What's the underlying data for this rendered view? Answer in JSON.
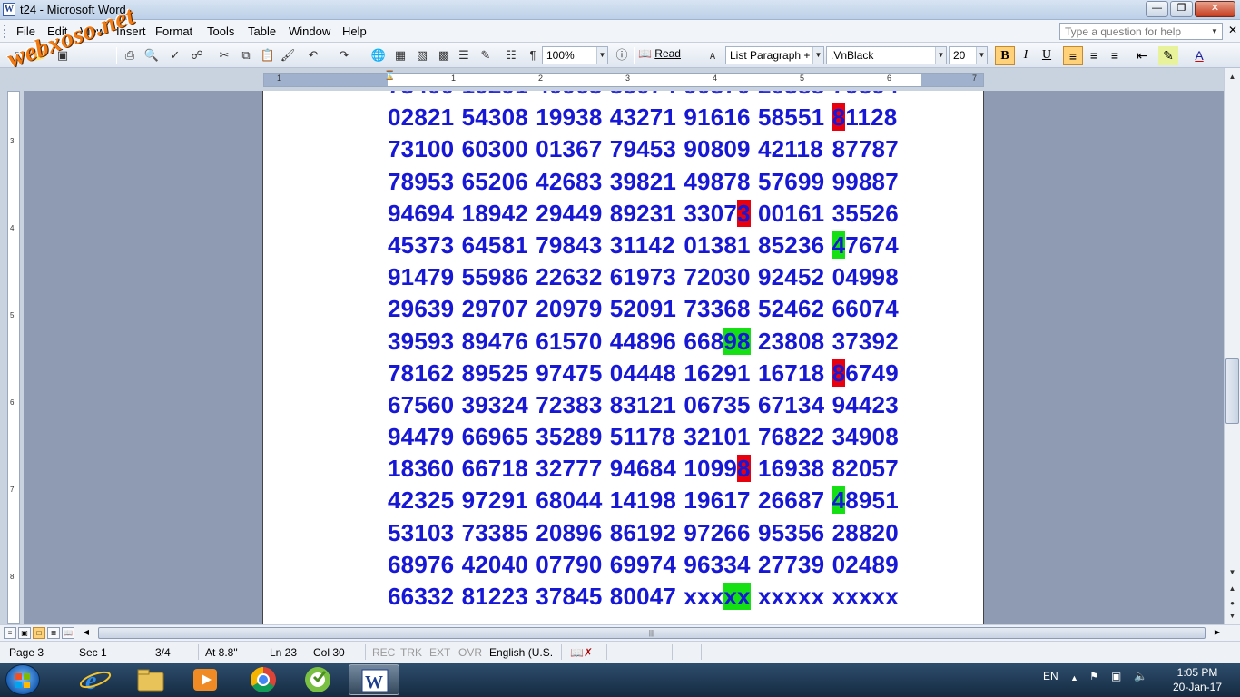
{
  "window": {
    "title": "t24 - Microsoft Word",
    "app_icon": "word-icon"
  },
  "menu": [
    {
      "label": "File"
    },
    {
      "label": "Edit"
    },
    {
      "label": "View"
    },
    {
      "label": "Insert"
    },
    {
      "label": "Format"
    },
    {
      "label": "Tools"
    },
    {
      "label": "Table"
    },
    {
      "label": "Window"
    },
    {
      "label": "Help"
    }
  ],
  "help_box": {
    "placeholder": "Type a question for help"
  },
  "toolbar": {
    "zoom": "100%",
    "read_label": "Read",
    "style": "List Paragraph +",
    "font": ".VnBlack",
    "size": "20",
    "bold_active": true
  },
  "ruler": {
    "marks": [
      "1",
      "1",
      "2",
      "3",
      "4",
      "5",
      "6",
      "7"
    ]
  },
  "vruler": {
    "marks": [
      "3",
      "4",
      "5",
      "6",
      "7",
      "8"
    ]
  },
  "document": {
    "rows": [
      [
        {
          "t": "02821"
        },
        {
          "t": "54308"
        },
        {
          "t": "19938"
        },
        {
          "t": "43271"
        },
        {
          "t": "91616"
        },
        {
          "t": "58551"
        },
        {
          "t": "81128",
          "hl": "red",
          "n": 1
        }
      ],
      [
        {
          "t": "73100"
        },
        {
          "t": "60300"
        },
        {
          "t": "01367"
        },
        {
          "t": "79453"
        },
        {
          "t": "90809"
        },
        {
          "t": "42118"
        },
        {
          "t": "87787"
        }
      ],
      [
        {
          "t": "78953"
        },
        {
          "t": "65206"
        },
        {
          "t": "42683"
        },
        {
          "t": "39821"
        },
        {
          "t": "49878"
        },
        {
          "t": "57699"
        },
        {
          "t": "99887"
        }
      ],
      [
        {
          "t": "94694"
        },
        {
          "t": "18942"
        },
        {
          "t": "29449"
        },
        {
          "t": "89231"
        },
        {
          "t": "33073",
          "hl": "red",
          "n": -1
        },
        {
          "t": "00161"
        },
        {
          "t": "35526"
        }
      ],
      [
        {
          "t": "45373"
        },
        {
          "t": "64581"
        },
        {
          "t": "79843"
        },
        {
          "t": "31142"
        },
        {
          "t": "01381"
        },
        {
          "t": "85236"
        },
        {
          "t": "47674",
          "hl": "green",
          "n": 1
        }
      ],
      [
        {
          "t": "91479"
        },
        {
          "t": "55986"
        },
        {
          "t": "22632"
        },
        {
          "t": "61973"
        },
        {
          "t": "72030"
        },
        {
          "t": "92452"
        },
        {
          "t": "04998"
        }
      ],
      [
        {
          "t": "29639"
        },
        {
          "t": "29707"
        },
        {
          "t": "20979"
        },
        {
          "t": "52091"
        },
        {
          "t": "73368"
        },
        {
          "t": "52462"
        },
        {
          "t": "66074"
        }
      ],
      [
        {
          "t": "39593"
        },
        {
          "t": "89476"
        },
        {
          "t": "61570"
        },
        {
          "t": "44896"
        },
        {
          "t": "66898",
          "hl": "green",
          "n": -2
        },
        {
          "t": "23808"
        },
        {
          "t": "37392"
        }
      ],
      [
        {
          "t": "78162"
        },
        {
          "t": "89525"
        },
        {
          "t": "97475"
        },
        {
          "t": "04448"
        },
        {
          "t": "16291"
        },
        {
          "t": "16718"
        },
        {
          "t": "86749",
          "hl": "red",
          "n": 1
        }
      ],
      [
        {
          "t": "67560"
        },
        {
          "t": "39324"
        },
        {
          "t": "72383"
        },
        {
          "t": "83121"
        },
        {
          "t": "06735"
        },
        {
          "t": "67134"
        },
        {
          "t": "94423"
        }
      ],
      [
        {
          "t": "94479"
        },
        {
          "t": "66965"
        },
        {
          "t": "35289"
        },
        {
          "t": "51178"
        },
        {
          "t": "32101"
        },
        {
          "t": "76822"
        },
        {
          "t": "34908"
        }
      ],
      [
        {
          "t": "18360"
        },
        {
          "t": "66718"
        },
        {
          "t": "32777"
        },
        {
          "t": "94684"
        },
        {
          "t": "10998",
          "hl": "red",
          "n": -1
        },
        {
          "t": "16938"
        },
        {
          "t": "82057"
        }
      ],
      [
        {
          "t": "42325"
        },
        {
          "t": "97291"
        },
        {
          "t": "68044"
        },
        {
          "t": "14198"
        },
        {
          "t": "19617"
        },
        {
          "t": "26687"
        },
        {
          "t": "48951",
          "hl": "green",
          "n": 1
        }
      ],
      [
        {
          "t": "53103"
        },
        {
          "t": "73385"
        },
        {
          "t": "20896"
        },
        {
          "t": "86192"
        },
        {
          "t": "97266"
        },
        {
          "t": "95356"
        },
        {
          "t": "28820"
        }
      ],
      [
        {
          "t": "68976"
        },
        {
          "t": "42040"
        },
        {
          "t": "07790"
        },
        {
          "t": "69974"
        },
        {
          "t": "96334"
        },
        {
          "t": "27739"
        },
        {
          "t": "02489"
        }
      ],
      [
        {
          "t": "66332"
        },
        {
          "t": "81223"
        },
        {
          "t": "37845"
        },
        {
          "t": "80047"
        },
        {
          "t": "xxxxx",
          "hl": "green",
          "n": -2
        },
        {
          "t": "xxxxx"
        },
        {
          "t": "xxxxx"
        }
      ]
    ],
    "highlight_colors": {
      "red": "#e8000e",
      "green": "#14e014"
    },
    "text_color": "#1717d6"
  },
  "status": {
    "page": "Page 3",
    "sec": "Sec 1",
    "pages": "3/4",
    "at": "At 8.8\"",
    "ln": "Ln 23",
    "col": "Col 30",
    "rec": "REC",
    "trk": "TRK",
    "ext": "EXT",
    "ovr": "OVR",
    "language": "English (U.S."
  },
  "taskbar": {
    "apps": [
      "internet-explorer-icon",
      "file-explorer-icon",
      "media-player-icon",
      "chrome-icon",
      "coccoc-icon",
      "word-icon"
    ],
    "lang": "EN",
    "time": "1:05 PM",
    "date": "20-Jan-17"
  },
  "watermark": "webxoso.net"
}
